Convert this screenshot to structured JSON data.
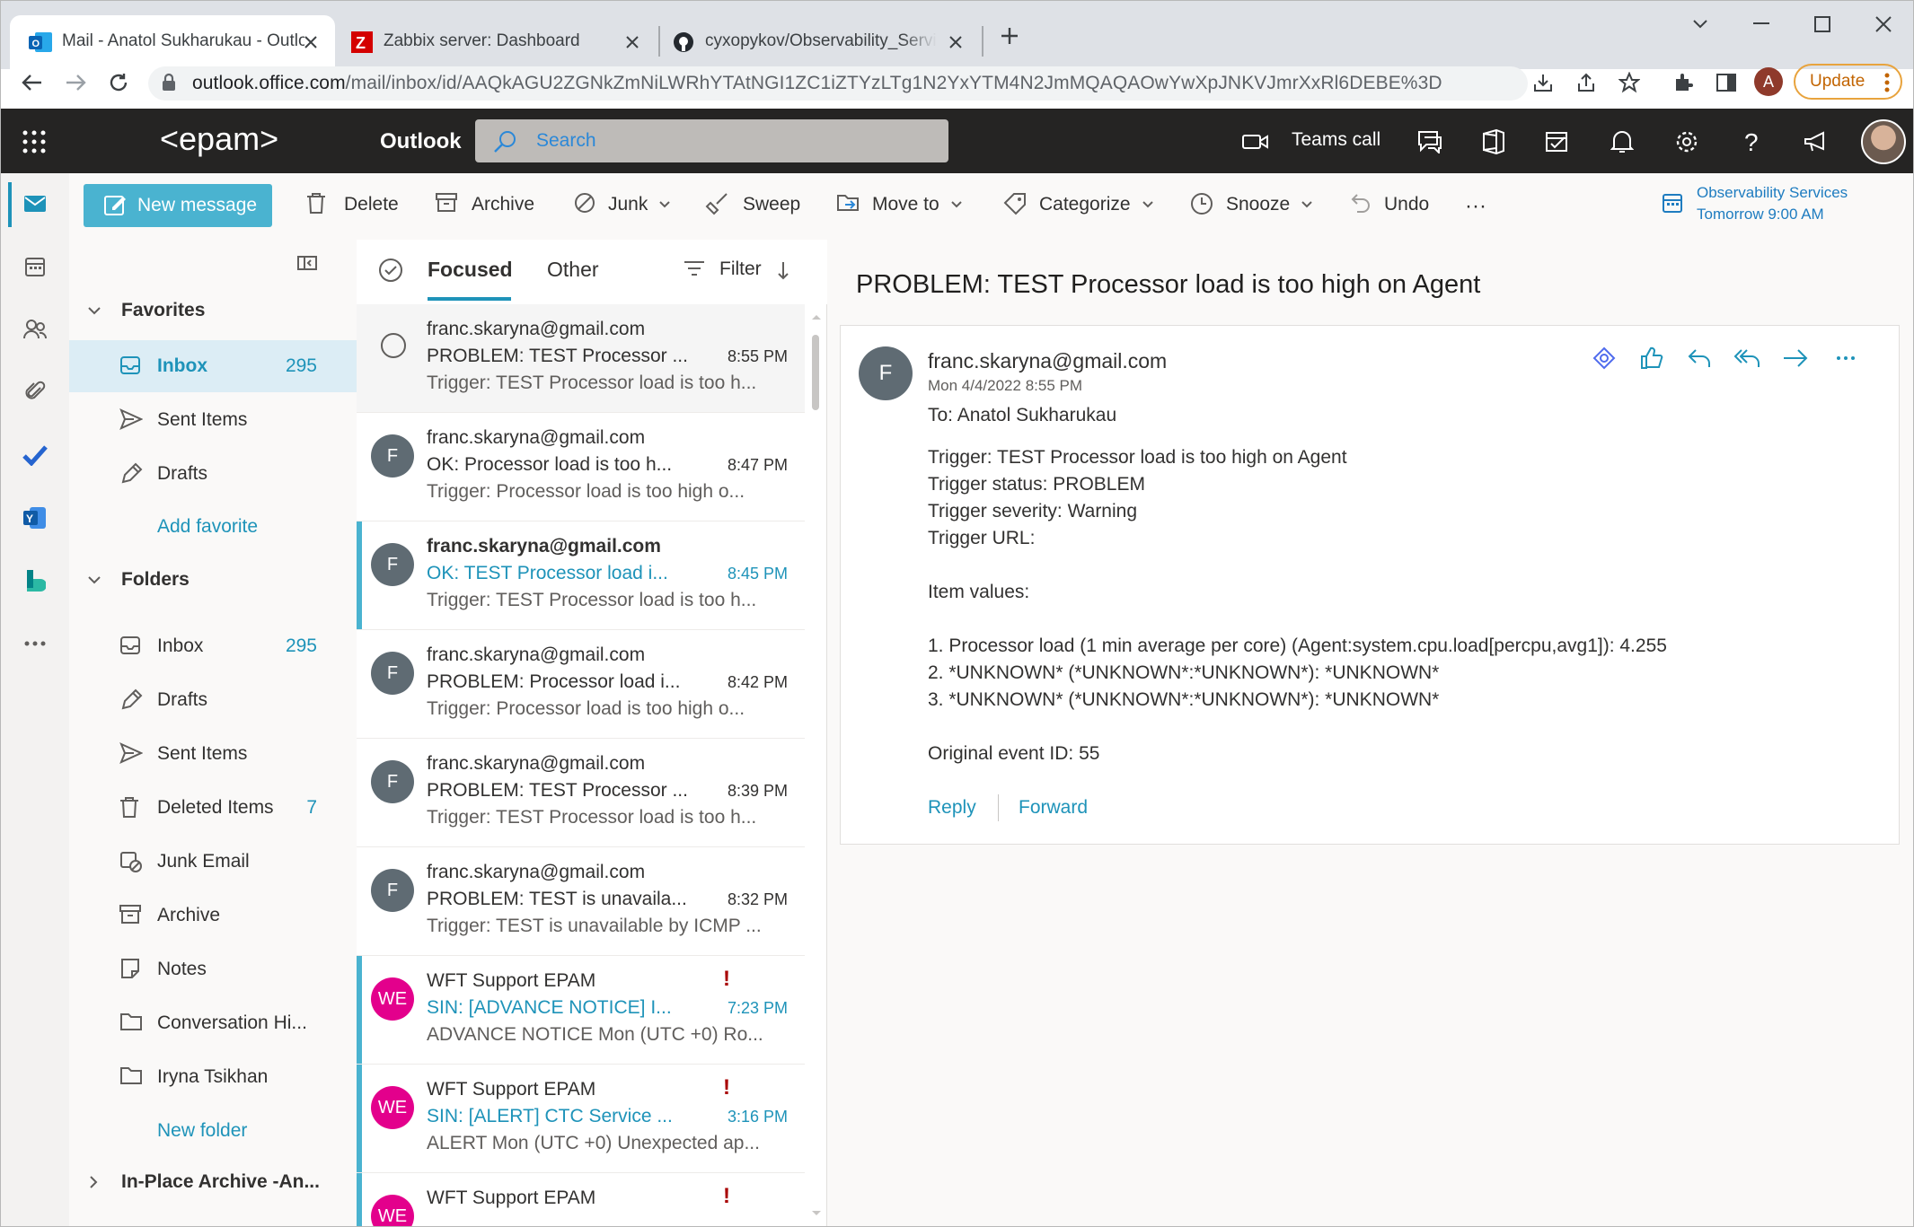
{
  "browser": {
    "tabs": [
      {
        "title": "Mail - Anatol Sukharukau - Outlo",
        "icon": "outlook-icon"
      },
      {
        "title": "Zabbix server: Dashboard",
        "icon": "zabbix-icon"
      },
      {
        "title": "cyxopykov/Observability_Service",
        "icon": "github-icon"
      }
    ],
    "url_host": "outlook.office.com",
    "url_path": "/mail/inbox/id/AAQkAGU2ZGNkZmNiLWRhYTAtNGI1ZC1iZTYzLTg1N2YxYTM4N2JmMQAQAOwYwXpJNKVJmrXxRl6DEBE%3D",
    "profile_initial": "A",
    "update_label": "Update"
  },
  "header": {
    "brand": "<epam>",
    "app_name": "Outlook",
    "search_placeholder": "Search",
    "teams_call": "Teams call"
  },
  "commands": {
    "new_message": "New message",
    "delete": "Delete",
    "archive": "Archive",
    "junk": "Junk",
    "sweep": "Sweep",
    "move_to": "Move to",
    "categorize": "Categorize",
    "snooze": "Snooze",
    "undo": "Undo",
    "more": "···"
  },
  "reminder": {
    "title": "Observability Services",
    "time": "Tomorrow 9:00 AM"
  },
  "folders": {
    "favorites_label": "Favorites",
    "favorites": [
      {
        "label": "Inbox",
        "count": "295"
      },
      {
        "label": "Sent Items",
        "count": ""
      },
      {
        "label": "Drafts",
        "count": ""
      }
    ],
    "add_favorite": "Add favorite",
    "folders_label": "Folders",
    "items": [
      {
        "label": "Inbox",
        "count": "295"
      },
      {
        "label": "Drafts",
        "count": ""
      },
      {
        "label": "Sent Items",
        "count": ""
      },
      {
        "label": "Deleted Items",
        "count": "7"
      },
      {
        "label": "Junk Email",
        "count": ""
      },
      {
        "label": "Archive",
        "count": ""
      },
      {
        "label": "Notes",
        "count": ""
      },
      {
        "label": "Conversation Hi...",
        "count": ""
      },
      {
        "label": "Iryna Tsikhan",
        "count": ""
      }
    ],
    "new_folder": "New folder",
    "in_place_archive": "In-Place Archive -An..."
  },
  "list": {
    "tab_focused": "Focused",
    "tab_other": "Other",
    "filter": "Filter",
    "messages": [
      {
        "avatar": "",
        "from": "franc.skaryna@gmail.com",
        "subject": "PROBLEM: TEST Processor ...",
        "time": "8:55 PM",
        "preview": "Trigger: TEST Processor load is too h..."
      },
      {
        "avatar": "F",
        "from": "franc.skaryna@gmail.com",
        "subject": "OK: Processor load is too h...",
        "time": "8:47 PM",
        "preview": "Trigger: Processor load is too high o..."
      },
      {
        "avatar": "F",
        "from": "franc.skaryna@gmail.com",
        "subject": "OK: TEST Processor load i...",
        "time": "8:45 PM",
        "preview": "Trigger: TEST Processor load is too h..."
      },
      {
        "avatar": "F",
        "from": "franc.skaryna@gmail.com",
        "subject": "PROBLEM: Processor load i...",
        "time": "8:42 PM",
        "preview": "Trigger: Processor load is too high o..."
      },
      {
        "avatar": "F",
        "from": "franc.skaryna@gmail.com",
        "subject": "PROBLEM: TEST Processor ...",
        "time": "8:39 PM",
        "preview": "Trigger: TEST Processor load is too h..."
      },
      {
        "avatar": "F",
        "from": "franc.skaryna@gmail.com",
        "subject": "PROBLEM: TEST is unavaila...",
        "time": "8:32 PM",
        "preview": "Trigger: TEST is unavailable by ICMP ..."
      },
      {
        "avatar": "WE",
        "from": "WFT Support EPAM",
        "subject": "SIN: [ADVANCE NOTICE] I...",
        "time": "7:23 PM",
        "preview": "ADVANCE NOTICE Mon (UTC +0) Ro...",
        "important": "!"
      },
      {
        "avatar": "WE",
        "from": "WFT Support EPAM",
        "subject": "SIN: [ALERT] CTC Service ...",
        "time": "3:16 PM",
        "preview": "ALERT Mon (UTC +0) Unexpected ap...",
        "important": "!"
      },
      {
        "avatar": "WE",
        "from": "WFT Support EPAM",
        "subject": "",
        "time": "",
        "preview": "",
        "important": "!"
      }
    ]
  },
  "reading": {
    "subject": "PROBLEM: TEST Processor load is too high on Agent",
    "avatar": "F",
    "from": "franc.skaryna@gmail.com",
    "date": "Mon 4/4/2022 8:55 PM",
    "to": "To:  Anatol Sukharukau",
    "body": [
      "Trigger: TEST Processor load is too high on Agent",
      "Trigger status: PROBLEM",
      "Trigger severity: Warning",
      "Trigger URL:",
      "Item values:",
      "1. Processor load (1 min average per core) (Agent:system.cpu.load[percpu,avg1]): 4.255",
      "2. *UNKNOWN* (*UNKNOWN*:*UNKNOWN*): *UNKNOWN*",
      "3. *UNKNOWN* (*UNKNOWN*:*UNKNOWN*): *UNKNOWN*",
      "Original event ID: 55"
    ],
    "reply": "Reply",
    "forward": "Forward"
  },
  "colors": {
    "accent": "#1e93b9",
    "header_bg": "#252423",
    "new_message_bg": "#4ab3d0",
    "avatar_we": "#e3008c",
    "important": "#a80000"
  }
}
